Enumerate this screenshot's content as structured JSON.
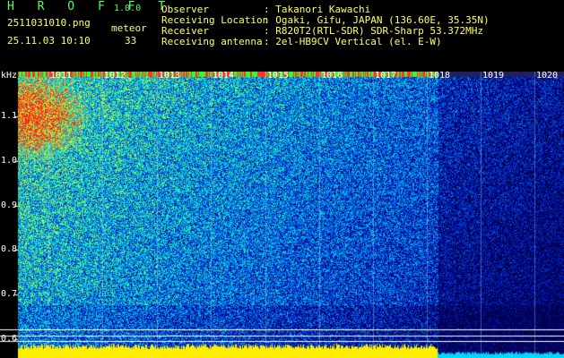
{
  "header": {
    "logo": "H R O F F T",
    "version": "1.0.0",
    "filename": "2511031010.png",
    "timestamp": "25.11.03 10:10",
    "event_label": "meteor",
    "event_count": "33",
    "fields": [
      {
        "label": "Observer",
        "value": ": Takanori Kawachi"
      },
      {
        "label": "Receiving Location",
        "value": ": Ogaki, Gifu, JAPAN (136.60E, 35.35N)"
      },
      {
        "label": "Receiver",
        "value": ": R820T2(RTL-SDR) SDR-Sharp 53.372MHz"
      },
      {
        "label": "Receiving antenna",
        "value": ": 2el-HB9CV Vertical (el. E-W)"
      }
    ]
  },
  "spectrogram": {
    "y_unit": "kHz",
    "y_ticks": [
      "1.1",
      "1.0",
      "0.9",
      "0.8",
      "0.7",
      "0.6"
    ],
    "x_ticks": [
      "1011",
      "1012",
      "1013",
      "1014",
      "1015",
      "1016",
      "1017",
      "1018",
      "1019",
      "1020"
    ],
    "colors": {
      "background": "#000000",
      "low": "#000080",
      "mid": "#00c0ff",
      "high": "#ffff00",
      "peak": "#ff2020",
      "baseline": "#ffff00"
    }
  }
}
